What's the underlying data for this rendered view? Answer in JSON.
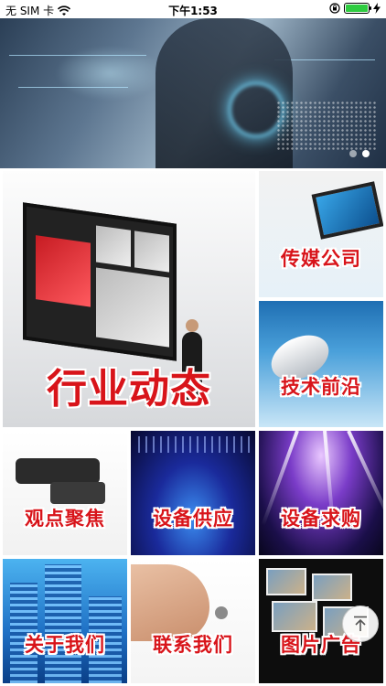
{
  "status_bar": {
    "carrier": "无 SIM 卡",
    "time": "下午1:53",
    "battery_level": 1.0
  },
  "banner": {
    "page_count": 2,
    "active_page": 2
  },
  "tiles": {
    "industry_news": "行业动态",
    "media_company": "传媒公司",
    "tech_frontier": "技术前沿",
    "viewpoint_focus": "观点聚焦",
    "equipment_supply": "设备供应",
    "equipment_purchase": "设备求购",
    "about_us": "关于我们",
    "contact_us": "联系我们",
    "picture_ads": "图片广告"
  },
  "colors": {
    "label_red": "#d8141a",
    "label_outline": "#ffffff"
  },
  "icons": {
    "back_to_top": "arrow-up-to-line-icon"
  }
}
